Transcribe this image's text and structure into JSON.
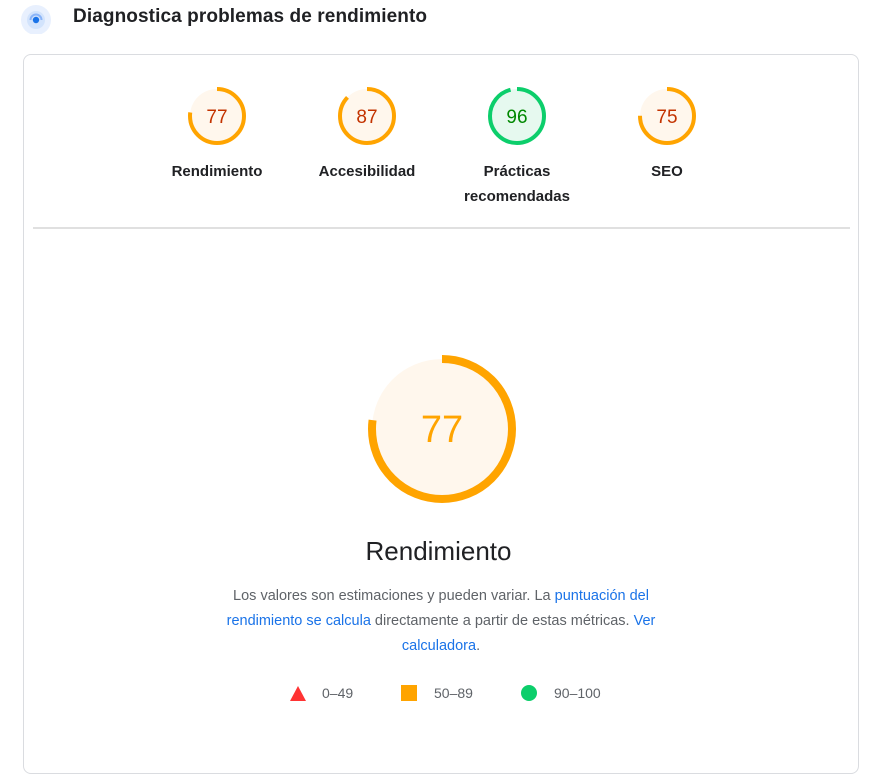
{
  "header": {
    "title": "Diagnostica problemas de rendimiento"
  },
  "categories": [
    {
      "score": "77",
      "label_lines": [
        "Rendimiento"
      ],
      "value": 77,
      "status": "average"
    },
    {
      "score": "87",
      "label_lines": [
        "Accesibilidad"
      ],
      "value": 87,
      "status": "average"
    },
    {
      "score": "96",
      "label_lines": [
        "Prácticas",
        "recomendadas"
      ],
      "value": 96,
      "status": "pass"
    },
    {
      "score": "75",
      "label_lines": [
        "SEO"
      ],
      "value": 75,
      "status": "average"
    }
  ],
  "main": {
    "score": "77",
    "value": 77,
    "title": "Rendimiento",
    "desc_part1": "Los valores son estimaciones y pueden variar. La ",
    "desc_link1": "puntuación del rendimiento se calcula",
    "desc_part2": " directamente a partir de estas métricas. ",
    "desc_link2": "Ver calculadora",
    "desc_part3": "."
  },
  "legend": {
    "fail": "0–49",
    "average": "50–89",
    "pass": "90–100"
  },
  "colors": {
    "average_ring": "#ffa400",
    "average_text_small": "#c33300",
    "average_text_big": "#ffa400",
    "average_fill": "#fff7ed",
    "pass_ring": "#0cce6b",
    "pass_text": "#008800",
    "pass_fill": "#e6f9ef",
    "fail": "#ff3333",
    "link": "#1a73e8",
    "header_icon": "#1a73e8"
  }
}
